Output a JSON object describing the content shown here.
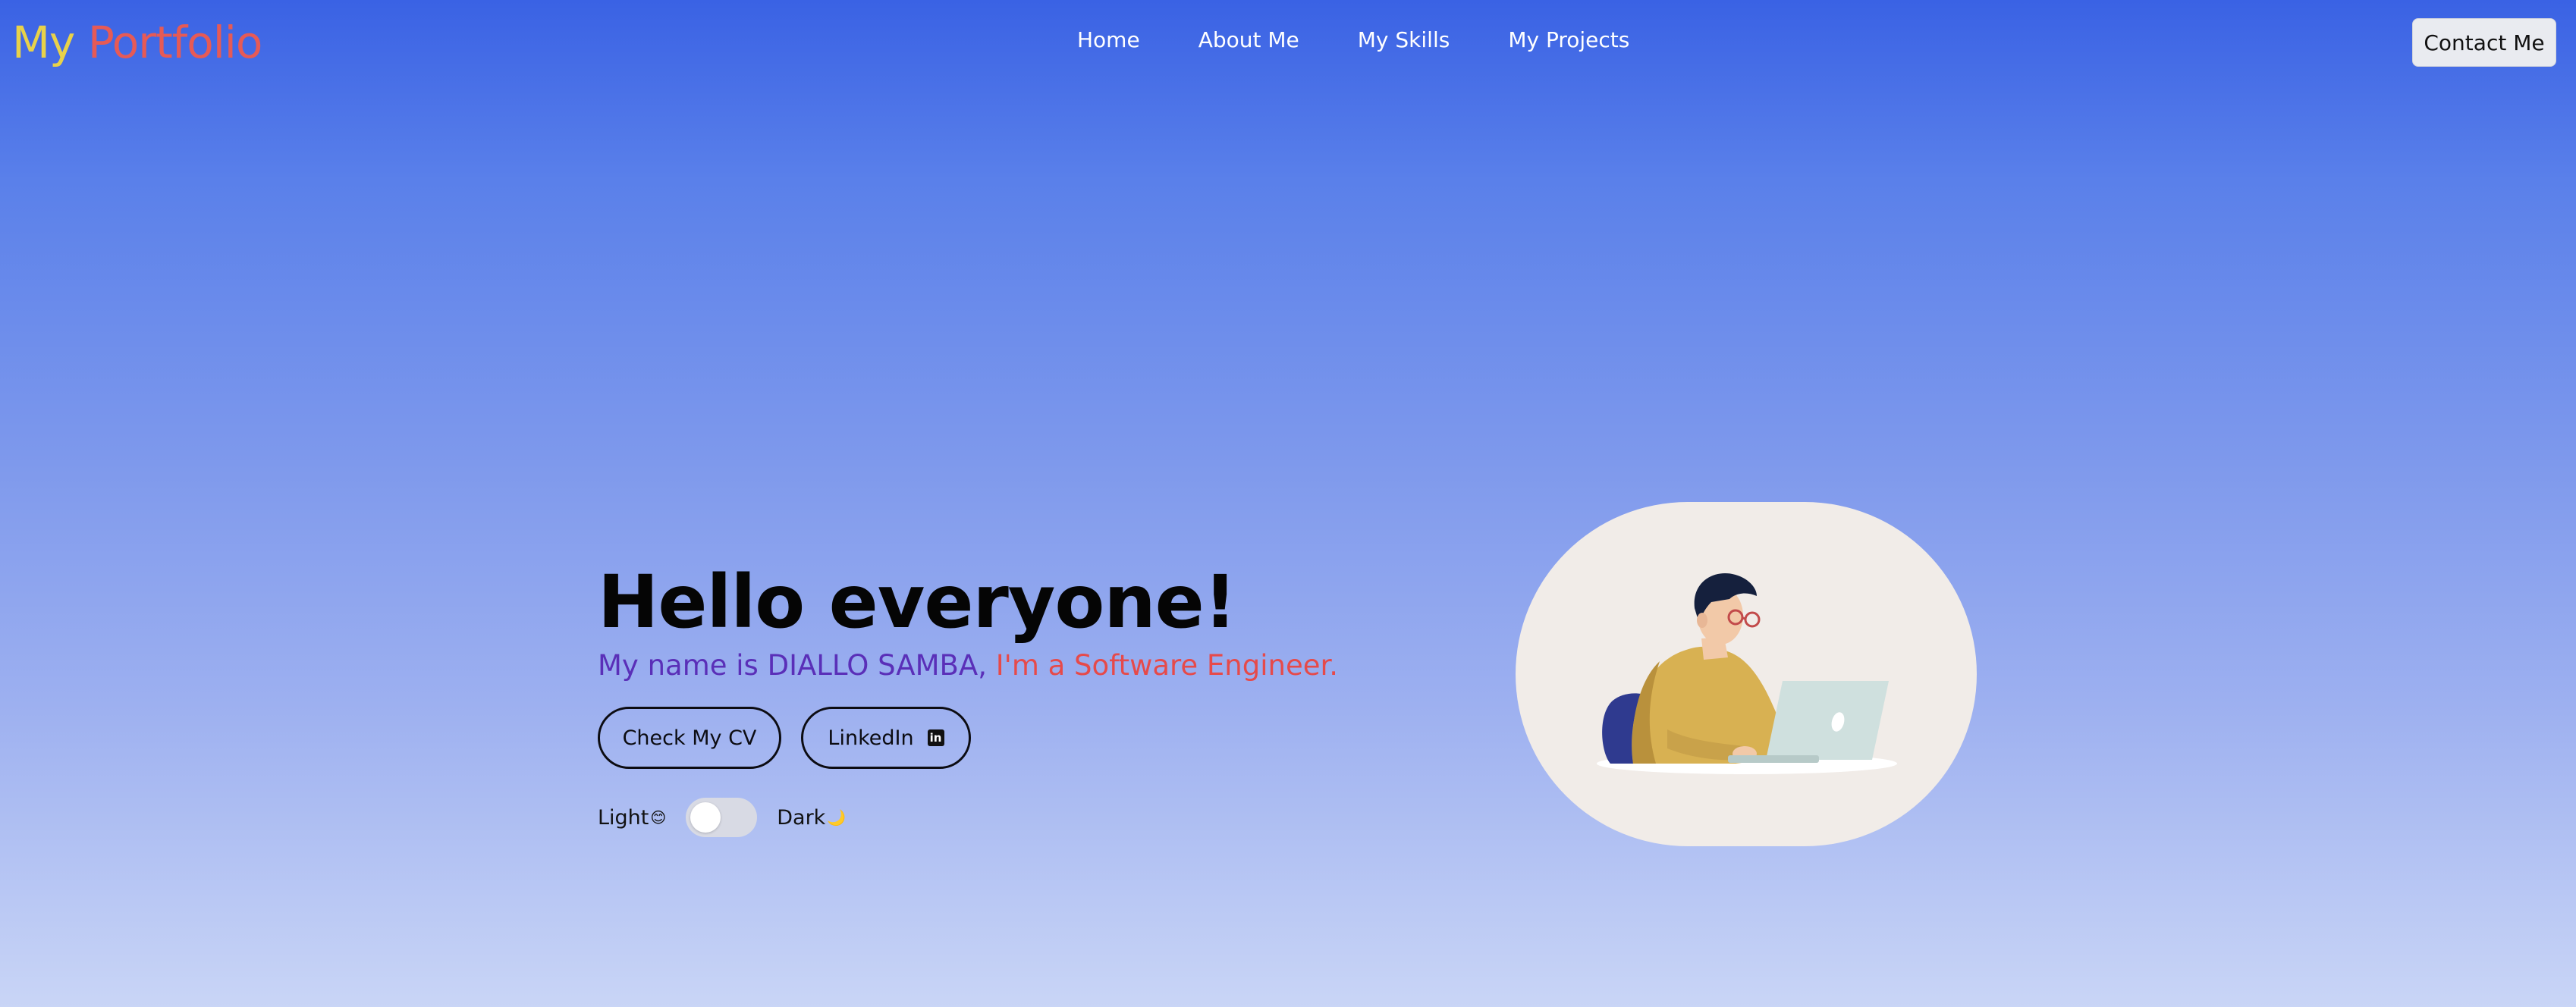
{
  "header": {
    "logo_my": "My",
    "logo_portfolio": "Portfolio",
    "nav": [
      {
        "label": "Home"
      },
      {
        "label": "About Me"
      },
      {
        "label": "My Skills"
      },
      {
        "label": "My Projects"
      }
    ],
    "contact_label": "Contact Me"
  },
  "hero": {
    "title": "Hello everyone!",
    "subtitle_name": "My name is DIALLO SAMBA,",
    "subtitle_role": "I'm a Software Engineer.",
    "cv_button": "Check My CV",
    "linkedin_button": "LinkedIn",
    "linkedin_icon": "in"
  },
  "theme_toggle": {
    "light_label": "Light",
    "light_emoji": "😊",
    "dark_label": "Dark",
    "dark_emoji": "🌙",
    "state": "light"
  },
  "colors": {
    "logo_my": "#e8d24a",
    "logo_portfolio": "#e65a56",
    "subtitle_name": "#5a2fb8",
    "subtitle_role": "#e64a4a",
    "gradient_top": "#3a62e4",
    "gradient_bottom": "#c9d5f6"
  },
  "illustration": {
    "icon": "developer-laptop-illustration"
  }
}
